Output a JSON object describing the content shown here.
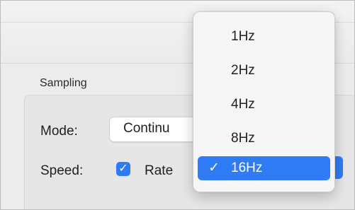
{
  "section": {
    "title": "Sampling"
  },
  "mode": {
    "label": "Mode:",
    "selected_value": "Continu"
  },
  "speed": {
    "label": "Speed:",
    "rate_checkbox_label": "Rate",
    "rate_checked": true,
    "checkbox_mark": "✓"
  },
  "dropdown_menu": {
    "items": [
      {
        "label": "1Hz",
        "selected": false
      },
      {
        "label": "2Hz",
        "selected": false
      },
      {
        "label": "4Hz",
        "selected": false
      },
      {
        "label": "8Hz",
        "selected": false
      },
      {
        "label": "16Hz",
        "selected": true
      }
    ],
    "selected_mark": "✓"
  },
  "colors": {
    "accent": "#2f7bf5",
    "window_bg": "#ececec",
    "menu_bg": "#f6f6f6"
  },
  "icons": {
    "checkbox_check": "checkmark-icon",
    "menu_selected": "checkmark-icon"
  }
}
